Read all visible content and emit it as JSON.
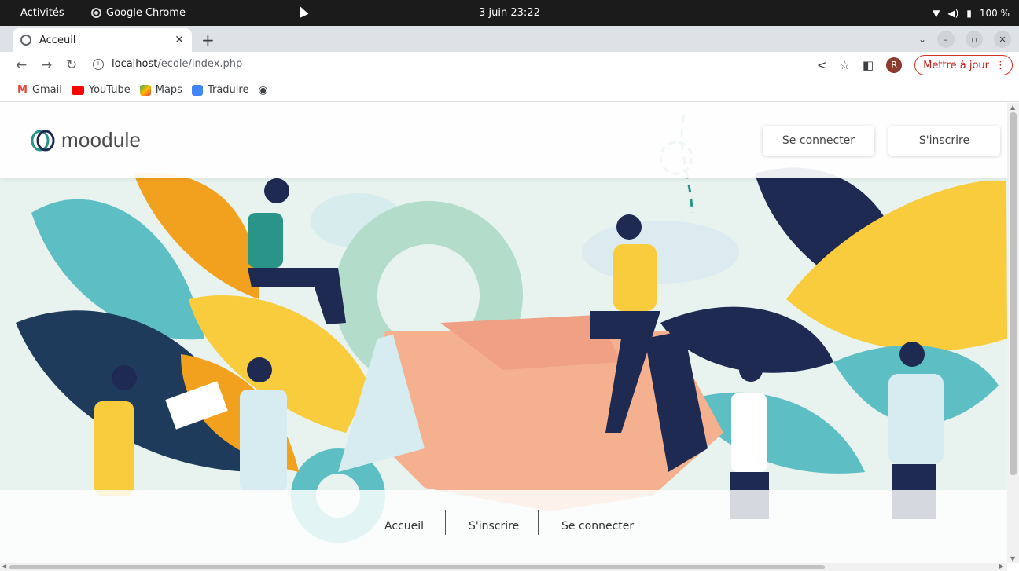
{
  "system_bar": {
    "activities": "Activités",
    "app_name": "Google Chrome",
    "clock": "3 juin  23:22",
    "battery": "100 %"
  },
  "browser": {
    "tab_title": "Acceuil",
    "new_tab": "+",
    "url_host": "localhost",
    "url_path": "/ecole/index.php",
    "profile_initial": "R",
    "update_label": "Mettre à jour",
    "bookmarks": [
      {
        "label": "Gmail",
        "color": "#ea4335"
      },
      {
        "label": "YouTube",
        "color": "#ff0000"
      },
      {
        "label": "Maps",
        "color": "#34a853"
      },
      {
        "label": "Traduire",
        "color": "#4285f4"
      }
    ]
  },
  "site": {
    "logo_text": "moodule",
    "header_login": "Se connecter",
    "header_signup": "S'inscrire",
    "footer_nav": [
      "Accueil",
      "S'inscrire",
      "Se connecter"
    ]
  },
  "colors": {
    "teal": "#5dbfc4",
    "navy": "#1f2a52",
    "yellow": "#f8cc3c",
    "orange": "#f2a11f",
    "skin": "#f4b08f",
    "update_red": "#d93025"
  }
}
